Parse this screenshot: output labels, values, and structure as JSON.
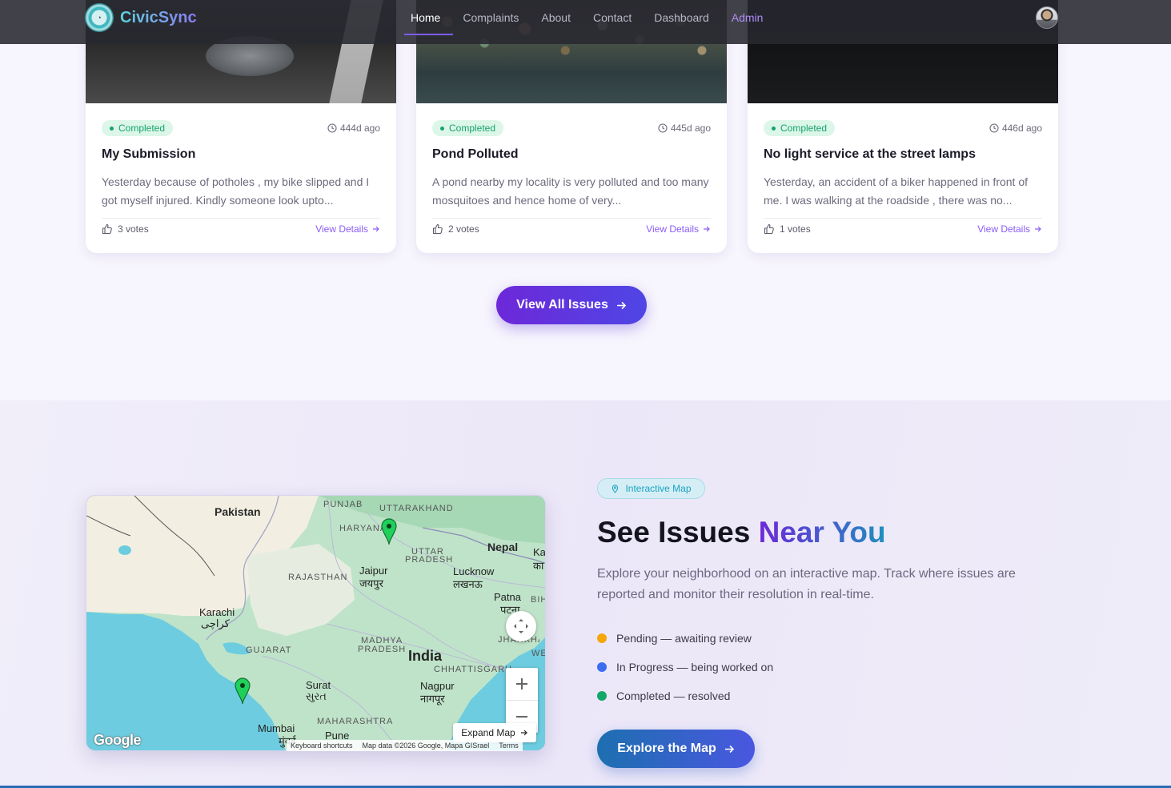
{
  "brand": {
    "name": "CivicSync"
  },
  "nav": {
    "links": [
      "Home",
      "Complaints",
      "About",
      "Contact",
      "Dashboard",
      "Admin"
    ],
    "active": "Home"
  },
  "cards": [
    {
      "status": "Completed",
      "age": "444d ago",
      "title": "My Submission",
      "description": "Yesterday because of potholes , my bike slipped and I got myself injured. Kindly someone look upto...",
      "votes": "3 votes",
      "link": "View Details"
    },
    {
      "status": "Completed",
      "age": "445d ago",
      "title": "Pond Polluted",
      "description": "A pond nearby my locality is very polluted and too many mosquitoes and hence home of very...",
      "votes": "2 votes",
      "link": "View Details"
    },
    {
      "status": "Completed",
      "age": "446d ago",
      "title": "No light service at the street lamps",
      "description": "Yesterday, an accident of a biker happened in front of me. I was walking at the roadside , there was no...",
      "votes": "1 votes",
      "link": "View Details"
    }
  ],
  "view_all": "View All Issues",
  "map_section": {
    "pill": "Interactive Map",
    "heading_plain": "See Issues ",
    "heading_accent": "Near You",
    "lede": "Explore your neighborhood on an interactive map. Track where issues are reported and monitor their resolution in real-time.",
    "legend": [
      {
        "label": "Pending — awaiting review",
        "color": "#f5a60a"
      },
      {
        "label": "In Progress — being worked on",
        "color": "#3b6df0"
      },
      {
        "label": "Completed — resolved",
        "color": "#12a86a"
      }
    ],
    "explore": "Explore the Map"
  },
  "map": {
    "labels": {
      "pakistan": "Pakistan",
      "punjab": "PUNJAB",
      "uttarakhand": "UTTARAKHAND",
      "haryana": "HARYANA",
      "uttar_pradesh_1": "UTTAR",
      "uttar_pradesh_2": "PRADESH",
      "nepal": "Nepal",
      "ka": "Ka",
      "ka_dev": "का",
      "rajasthan": "RAJASTHAN",
      "jaipur": "Jaipur",
      "jaipur_dev": "जयपुर",
      "lucknow": "Lucknow",
      "lucknow_dev": "लखनऊ",
      "patna": "Patna",
      "patna_dev": "पटना",
      "bih": "BIH",
      "karachi": "Karachi",
      "karachi_ur": "کراچی",
      "gujarat": "GUJARAT",
      "madhya_1": "MADHYA",
      "madhya_2": "PRADESH",
      "india": "India",
      "jhar": "JHARKHAND",
      "we": "WE",
      "chhattisgarh": "CHHATTISGARH",
      "surat": "Surat",
      "surat_gu": "સુરત",
      "nagpur": "Nagpur",
      "nagpur_dev": "नागपूर",
      "maharashtra": "MAHARASHTRA",
      "mumbai": "Mumbai",
      "mumbai_dev": "मुंबई",
      "pune": "Pune"
    },
    "expand": "Expand Map",
    "google": "Google",
    "attribution": [
      "Keyboard shortcuts",
      "Map data ©2026 Google, Mapa GISrael",
      "Terms"
    ],
    "marker_color": "#1fd05a"
  }
}
